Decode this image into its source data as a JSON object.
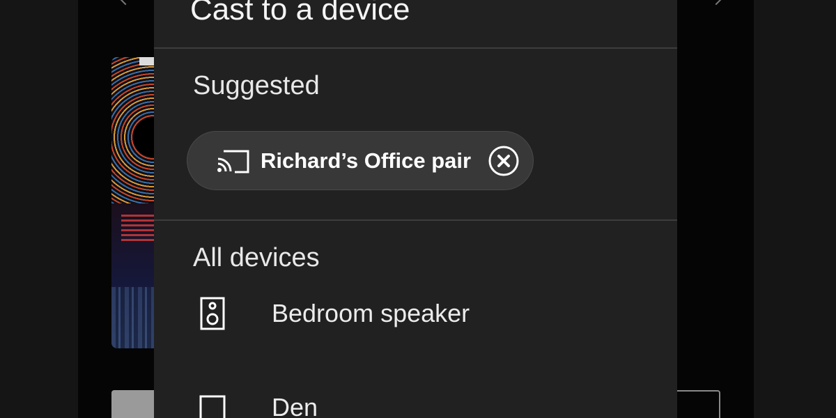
{
  "dialog": {
    "title": "Cast to a device"
  },
  "suggested": {
    "header": "Suggested",
    "chip": {
      "icon": "cast-icon",
      "label": "Richard’s Office pair",
      "remove_icon": "close-circle-icon"
    }
  },
  "all_devices": {
    "header": "All devices",
    "items": [
      {
        "label": "Bedroom speaker",
        "icon": "speaker-icon"
      },
      {
        "label": "Den",
        "icon": "tv-icon"
      }
    ]
  },
  "colors": {
    "dialog_background": "#212121",
    "backdrop": "#151515",
    "chip_background": "#383838",
    "text": "#ffffff",
    "divider": "#3d3d3d"
  }
}
